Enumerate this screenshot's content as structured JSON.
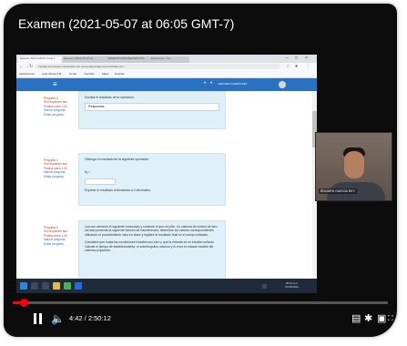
{
  "video": {
    "title": "Examen (2021-05-07 at 06:05 GMT-7)",
    "time_display": "4:42 / 2:50:12",
    "progress_fraction": 0.028
  },
  "webcam": {
    "participant_name": "EDUARD GARCÍA REY"
  },
  "browser": {
    "tabs": [
      "Examen MATLAB PC Final 1",
      "Examen (2021-05-07 at...",
      "ORDEN/TODAS/RECEPCIÓN",
      "Exámenes / cla..."
    ],
    "url": "moodle.tecnologicomanzanillo.edu.mx/mod/quiz/attempt.php?attempt=...",
    "bookmarks": [
      "Aplicaciones",
      "Aula Virtual ITM",
      "Gmail",
      "YouTube",
      "Maps",
      "Noticias"
    ]
  },
  "moodle": {
    "user_label": "EDUARD GARCÍA REY"
  },
  "questions": [
    {
      "info_status": "Pregunta 3",
      "info_state": "Sin responder aún",
      "info_points": "Puntúa como 1,00",
      "info_flag": "Marcar pregunta",
      "info_edit": "Editar pregunta",
      "text": "Escriba el resultado de la operación.",
      "answer": "Respuesta:"
    },
    {
      "info_status": "Pregunta 4",
      "info_state": "Sin responder aún",
      "info_points": "Puntúa como 1,00",
      "info_flag": "Marcar pregunta",
      "info_edit": "Editar pregunta",
      "text": "Obtenga el resultado de la siguiente operación:",
      "answer_label": "b) =",
      "answer": "",
      "note": "Exprese el resultado redondeado a 2 decimales."
    },
    {
      "info_status": "Pregunta 5",
      "info_state": "Sin responder aún",
      "info_points": "Puntúa como 1,00",
      "info_flag": "Marcar pregunta",
      "info_edit": "Editar pregunta",
      "text": "Lea con atención el siguiente enunciado y conteste lo que se pide. Un sistema de control de lazo cerrado presenta la siguiente función de transferencia, determine los valores correspondientes utilizando el procedimiento visto en clase y registre el resultado final en el campo indicado.",
      "text2": "Considere que todas las condiciones iniciales son cero y que la entrada es un escalón unitario. Calcule el tiempo de establecimiento, el sobreimpulso máximo y el error en estado estable del sistema propuesto."
    }
  ],
  "taskbar": {
    "clock_time": "06:10 a.m.",
    "clock_date": "07/05/2021"
  },
  "colors": {
    "moodle_blue": "#2a72c1",
    "question_box": "#dff0f8",
    "progress_red": "#ff0000"
  },
  "icons": [
    "play-pause-icon",
    "volume-icon",
    "subtitles-icon",
    "settings-icon",
    "miniplayer-icon",
    "fullscreen-icon"
  ]
}
